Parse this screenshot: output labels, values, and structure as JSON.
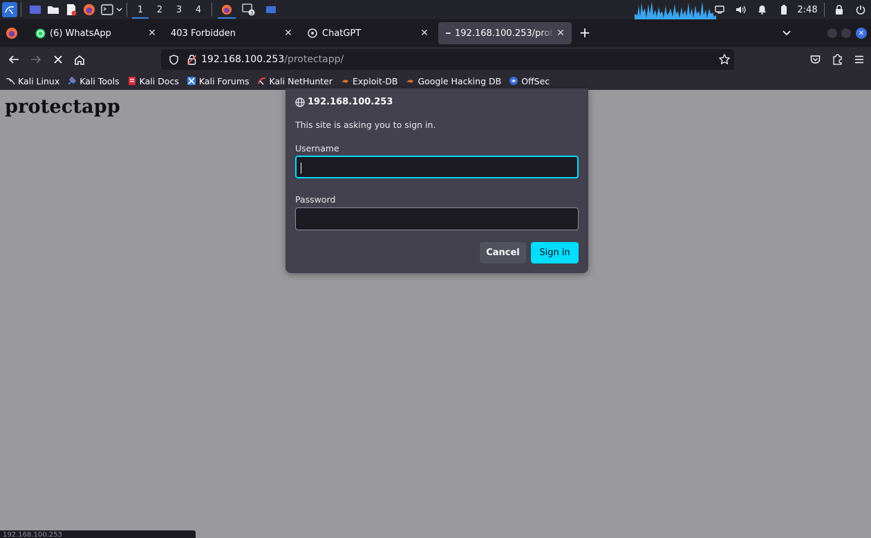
{
  "panel": {
    "workspaces": [
      "1",
      "2",
      "3",
      "4"
    ],
    "active_workspace": "1",
    "clock": "2:48",
    "accent_color": "#3584e4"
  },
  "tabs": [
    {
      "label": "(6) WhatsApp",
      "icon": "whatsapp-icon",
      "selected": false
    },
    {
      "label": "403 Forbidden",
      "icon": "",
      "selected": false
    },
    {
      "label": "ChatGPT",
      "icon": "chatgpt-icon",
      "selected": false
    },
    {
      "label": "192.168.100.253/protectapp/",
      "icon": "loading-icon",
      "selected": true
    }
  ],
  "urlbar": {
    "host": "192.168.100.253",
    "path": "/protectapp/"
  },
  "bookmarks": [
    {
      "label": "Kali Linux",
      "icon": "kali-icon"
    },
    {
      "label": "Kali Tools",
      "icon": "kali-tools-icon"
    },
    {
      "label": "Kali Docs",
      "icon": "kali-docs-icon"
    },
    {
      "label": "Kali Forums",
      "icon": "kali-forums-icon"
    },
    {
      "label": "Kali NetHunter",
      "icon": "nethunter-icon"
    },
    {
      "label": "Exploit-DB",
      "icon": "exploit-db-icon"
    },
    {
      "label": "Google Hacking DB",
      "icon": "ghdb-icon"
    },
    {
      "label": "OffSec",
      "icon": "offsec-icon"
    }
  ],
  "page": {
    "heading": "protectapp"
  },
  "dialog": {
    "host": "192.168.100.253",
    "message": "This site is asking you to sign in.",
    "username_label": "Username",
    "username_value": "",
    "password_label": "Password",
    "password_value": "",
    "cancel_label": "Cancel",
    "signin_label": "Sign in",
    "accent_color": "#00ddff"
  },
  "status": {
    "text": "192.168.100.253"
  }
}
